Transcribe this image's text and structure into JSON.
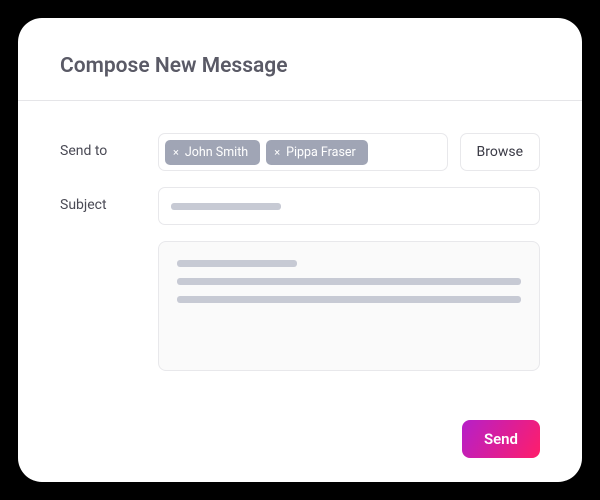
{
  "header": {
    "title": "Compose New Message"
  },
  "form": {
    "send_to_label": "Send to",
    "subject_label": "Subject",
    "browse_label": "Browse",
    "recipients": [
      {
        "name": "John Smith"
      },
      {
        "name": "Pippa Fraser"
      }
    ]
  },
  "footer": {
    "send_label": "Send"
  }
}
